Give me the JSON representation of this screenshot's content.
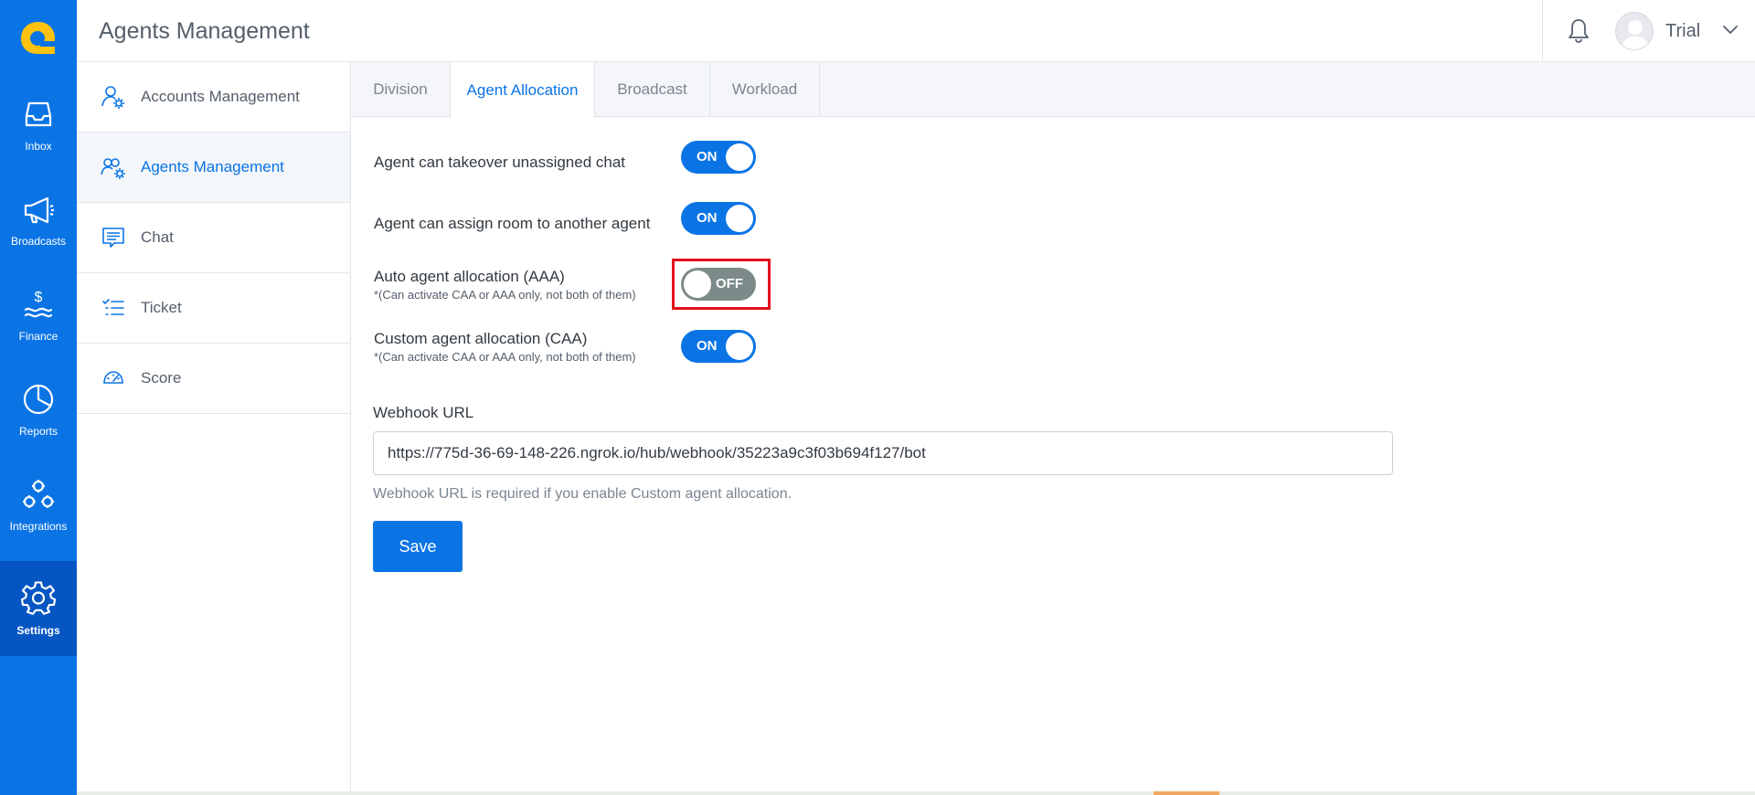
{
  "colors": {
    "accent": "#0b74e5",
    "rail_active": "#0556c2",
    "toggle_off": "#7d8a8a",
    "highlight": "#e3101c"
  },
  "app": {
    "logo_icon": "q-logo-icon"
  },
  "rail": {
    "items": [
      {
        "label": "Inbox",
        "icon": "inbox-icon"
      },
      {
        "label": "Broadcasts",
        "icon": "megaphone-icon"
      },
      {
        "label": "Finance",
        "icon": "finance-icon"
      },
      {
        "label": "Reports",
        "icon": "pie-chart-icon"
      },
      {
        "label": "Integrations",
        "icon": "integrations-icon"
      },
      {
        "label": "Settings",
        "icon": "gear-icon",
        "active": true
      }
    ]
  },
  "header": {
    "title": "Agents Management",
    "user_name": "Trial",
    "bell_icon": "bell-icon",
    "chevron_icon": "chevron-down-icon"
  },
  "subnav": {
    "items": [
      {
        "label": "Accounts Management",
        "icon": "user-gear-icon"
      },
      {
        "label": "Agents Management",
        "icon": "users-gear-icon",
        "active": true
      },
      {
        "label": "Chat",
        "icon": "chat-icon"
      },
      {
        "label": "Ticket",
        "icon": "checklist-icon"
      },
      {
        "label": "Score",
        "icon": "gauge-icon"
      }
    ]
  },
  "tabs": [
    {
      "label": "Division"
    },
    {
      "label": "Agent Allocation",
      "active": true
    },
    {
      "label": "Broadcast"
    },
    {
      "label": "Workload"
    }
  ],
  "settings": {
    "takeover": {
      "label": "Agent can takeover unassigned chat",
      "state": "ON"
    },
    "assign_room": {
      "label": "Agent can assign room to another agent",
      "state": "ON"
    },
    "aaa": {
      "label": "Auto agent allocation (AAA)",
      "note": "*(Can activate CAA or AAA only, not both of them)",
      "state": "OFF"
    },
    "caa": {
      "label": "Custom agent allocation (CAA)",
      "note": "*(Can activate CAA or AAA only, not both of them)",
      "state": "ON"
    }
  },
  "webhook": {
    "label": "Webhook URL",
    "value": "https://775d-36-69-148-226.ngrok.io/hub/webhook/35223a9c3f03b694f127/bot",
    "help": "Webhook URL is required if you enable Custom agent allocation."
  },
  "save_label": "Save"
}
